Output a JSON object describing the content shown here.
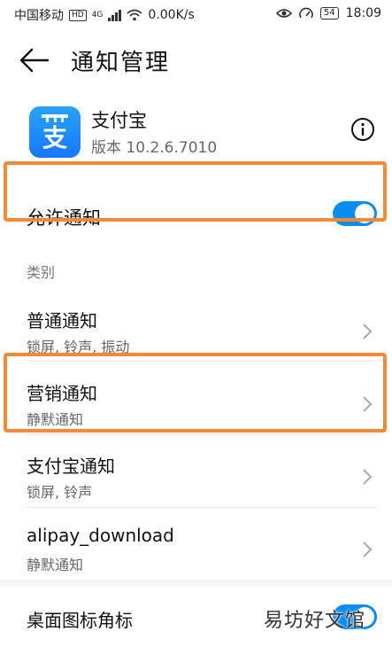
{
  "status_bar": {
    "carrier": "中国移动",
    "hd_badge": "HD",
    "network_type": "4G",
    "speed": "0.00K/s",
    "battery": "54",
    "time": "18:09"
  },
  "header": {
    "title": "通知管理",
    "back_icon": "arrow-left-icon"
  },
  "app": {
    "name": "支付宝",
    "version": "版本 10.2.6.7010",
    "icon_text": "支",
    "icon_colors": [
      "#2aa3f5",
      "#1677ff"
    ]
  },
  "allow_notifications": {
    "label": "允许通知",
    "enabled": true
  },
  "categories": {
    "section_label": "类别",
    "items": [
      {
        "title": "普通通知",
        "subtitle": "锁屏, 铃声, 振动"
      },
      {
        "title": "营销通知",
        "subtitle": "静默通知"
      },
      {
        "title": "支付宝通知",
        "subtitle": "锁屏, 铃声"
      },
      {
        "title": "alipay_download",
        "subtitle": "静默通知"
      }
    ]
  },
  "desktop_badge": {
    "label": "桌面图标角标",
    "enabled": true
  },
  "watermark": "易坊好文馆",
  "colors": {
    "accent": "#0a8df2",
    "highlight": "#f38a35"
  }
}
